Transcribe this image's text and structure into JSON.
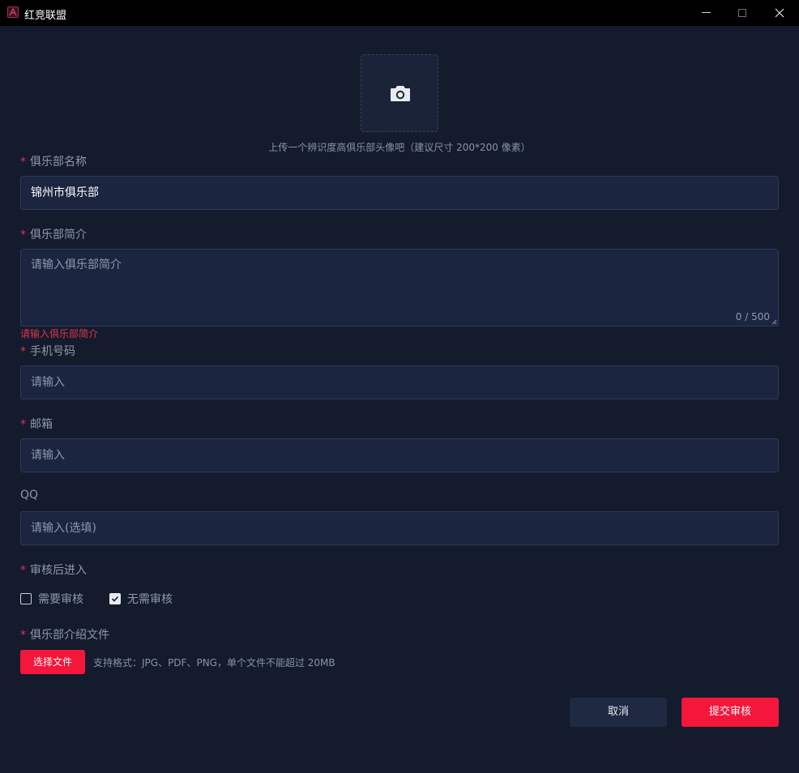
{
  "window": {
    "title": "红竞联盟",
    "icon": "app-logo-icon",
    "controls": [
      "minimize-icon",
      "maximize-icon",
      "close-icon"
    ]
  },
  "avatar": {
    "icon": "camera-icon",
    "hint": "上传一个辨识度高俱乐部头像吧（建议尺寸 200*200 像素）"
  },
  "form": {
    "required_mark": "*",
    "club_name": {
      "label": "俱乐部名称",
      "value": "锦州市俱乐部"
    },
    "club_intro": {
      "label": "俱乐部简介",
      "placeholder": "请输入俱乐部简介",
      "counter": "0 / 500",
      "error": "请输入俱乐部简介"
    },
    "phone": {
      "label": "手机号码",
      "placeholder": "请输入"
    },
    "email": {
      "label": "邮箱",
      "placeholder": "请输入"
    },
    "qq": {
      "label": "QQ",
      "placeholder": "请输入(选填)"
    },
    "review": {
      "label": "审核后进入",
      "options": [
        {
          "label": "需要审核",
          "checked": false
        },
        {
          "label": "无需审核",
          "checked": true
        }
      ]
    },
    "intro_file": {
      "label": "俱乐部介绍文件",
      "button": "选择文件",
      "hint": "支持格式：JPG、PDF、PNG，单个文件不能超过 20MB"
    }
  },
  "actions": {
    "cancel": "取消",
    "submit": "提交审核"
  },
  "colors": {
    "accent": "#f5163b",
    "background": "#131b2d",
    "input_bg": "#1b2540",
    "error": "#e0344d"
  }
}
